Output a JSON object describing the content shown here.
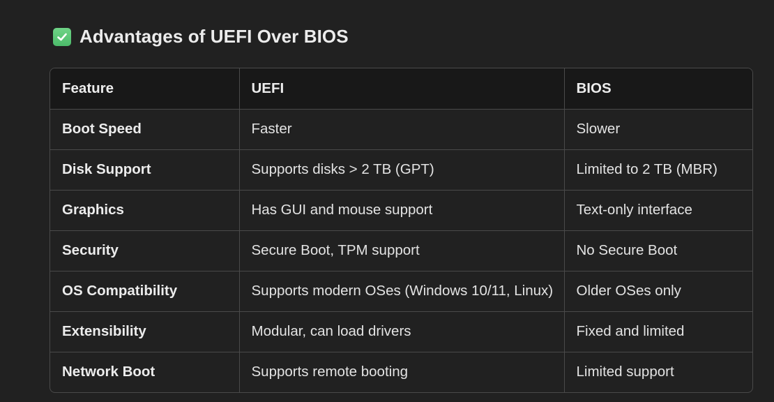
{
  "heading": {
    "icon": "check-mark-button-icon",
    "icon_color": "#58c474",
    "title": "Advantages of UEFI Over BIOS"
  },
  "table": {
    "headers": [
      "Feature",
      "UEFI",
      "BIOS"
    ],
    "rows": [
      [
        "Boot Speed",
        "Faster",
        "Slower"
      ],
      [
        "Disk Support",
        "Supports disks > 2 TB (GPT)",
        "Limited to 2 TB (MBR)"
      ],
      [
        "Graphics",
        "Has GUI and mouse support",
        "Text-only interface"
      ],
      [
        "Security",
        "Secure Boot, TPM support",
        "No Secure Boot"
      ],
      [
        "OS Compatibility",
        "Supports modern OSes (Windows 10/11, Linux)",
        "Older OSes only"
      ],
      [
        "Extensibility",
        "Modular, can load drivers",
        "Fixed and limited"
      ],
      [
        "Network Boot",
        "Supports remote booting",
        "Limited support"
      ]
    ]
  }
}
